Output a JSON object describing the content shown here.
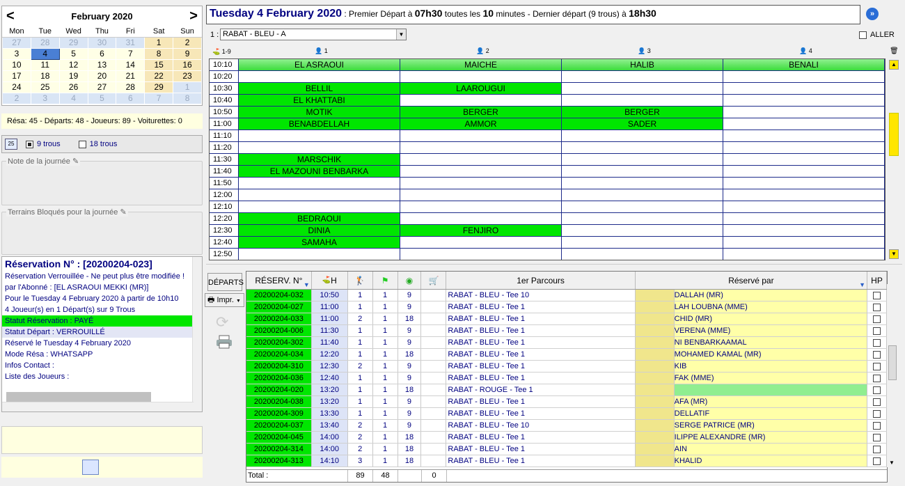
{
  "calendar": {
    "month": "February 2020",
    "prev": "<",
    "next": ">",
    "weekdays": [
      "Mon",
      "Tue",
      "Wed",
      "Thu",
      "Fri",
      "Sat",
      "Sun"
    ],
    "weeks": [
      [
        "27",
        "28",
        "29",
        "30",
        "31",
        "1",
        "2"
      ],
      [
        "3",
        "4",
        "5",
        "6",
        "7",
        "8",
        "9"
      ],
      [
        "10",
        "11",
        "12",
        "13",
        "14",
        "15",
        "16"
      ],
      [
        "17",
        "18",
        "19",
        "20",
        "21",
        "22",
        "23"
      ],
      [
        "24",
        "25",
        "26",
        "27",
        "28",
        "29",
        "1"
      ],
      [
        "2",
        "3",
        "4",
        "5",
        "6",
        "7",
        "8"
      ]
    ],
    "selected": "4"
  },
  "stats": "Résa: 45 - Départs: 48 - Joueurs: 89 - Voiturettes: 0",
  "holes": {
    "cal_icon": "25",
    "nine": "9 trous",
    "eighteen": "18 trous"
  },
  "note_label": "Note de la journée",
  "blocked_label": "Terrains Bloqués pour la journée",
  "reservation": {
    "title": "Réservation N° : [20200204-023]",
    "lines": [
      "Réservation Verrouillée - Ne peut plus être modifiée !",
      "par l'Abonné : [EL ASRAOUI MEKKI (MR)]",
      "Pour le Tuesday 4 February 2020 à partir de 10h10",
      "4 Joueur(s) en 1 Départ(s) sur 9 Trous"
    ],
    "status_paid": "Statut Réservation : PAYÉ",
    "status_locked": "Statut Départ : VERROUILLÉ",
    "lines2": [
      "Réservé le Tuesday 4 February 2020",
      "Mode Résa : WHATSAPP",
      "Infos Contact :",
      "Liste des Joueurs :"
    ]
  },
  "topbar": {
    "date": "Tuesday 4 February 2020",
    "p1": " : Premier Départ à ",
    "t1": "07h30",
    "p2": " toutes les ",
    "t2": "10",
    "p3": " minutes - Dernier départ (9 trous) à ",
    "t3": "18h30"
  },
  "course": {
    "label": "1 :",
    "value": "RABAT - BLEU - A",
    "aller": "ALLER"
  },
  "grid": {
    "hole_hdr": "1-9",
    "players": [
      "1",
      "2",
      "3",
      "4"
    ],
    "rows": [
      {
        "t": "10:10",
        "c": [
          "EL ASRAOUI",
          "MAICHE",
          "HALIB",
          "BENALI"
        ],
        "h": true
      },
      {
        "t": "10:20",
        "c": [
          "",
          "",
          "",
          ""
        ]
      },
      {
        "t": "10:30",
        "c": [
          "BELLIL",
          "LAAROUGUI",
          "",
          ""
        ]
      },
      {
        "t": "10:40",
        "c": [
          "EL KHATTABI",
          "",
          "",
          ""
        ]
      },
      {
        "t": "10:50",
        "c": [
          "MOTIK",
          "BERGER",
          "BERGER",
          ""
        ]
      },
      {
        "t": "11:00",
        "c": [
          "BENABDELLAH",
          "AMMOR",
          "SADER",
          ""
        ]
      },
      {
        "t": "11:10",
        "c": [
          "",
          "",
          "",
          ""
        ]
      },
      {
        "t": "11:20",
        "c": [
          "",
          "",
          "",
          ""
        ]
      },
      {
        "t": "11:30",
        "c": [
          "MARSCHIK",
          "",
          "",
          ""
        ]
      },
      {
        "t": "11:40",
        "c": [
          "EL MAZOUNI BENBARKA",
          "",
          "",
          ""
        ]
      },
      {
        "t": "11:50",
        "c": [
          "",
          "",
          "",
          ""
        ]
      },
      {
        "t": "12:00",
        "c": [
          "",
          "",
          "",
          ""
        ]
      },
      {
        "t": "12:10",
        "c": [
          "",
          "",
          "",
          ""
        ]
      },
      {
        "t": "12:20",
        "c": [
          "BEDRAOUI",
          "",
          "",
          ""
        ]
      },
      {
        "t": "12:30",
        "c": [
          "DINIA",
          "FENJIRO",
          "",
          ""
        ]
      },
      {
        "t": "12:40",
        "c": [
          "SAMAHA",
          "",
          "",
          ""
        ]
      },
      {
        "t": "12:50",
        "c": [
          "",
          "",
          "",
          ""
        ]
      }
    ]
  },
  "bottom": {
    "departs": "DÉPARTS",
    "impr": "Impr.",
    "headers": {
      "resa": "RÉSERV. N°",
      "h": "H",
      "parcours": "1er Parcours",
      "reserve_par": "Réservé par",
      "hp": "HP"
    },
    "rows": [
      [
        "20200204-032",
        "10:50",
        "1",
        "1",
        "9",
        "",
        "RABAT - BLEU - Tee 10",
        "DALLAH (MR)"
      ],
      [
        "20200204-027",
        "11:00",
        "1",
        "1",
        "9",
        "",
        "RABAT - BLEU - Tee 1",
        "LAH LOUBNA (MME)"
      ],
      [
        "20200204-033",
        "11:00",
        "2",
        "1",
        "18",
        "",
        "RABAT - BLEU - Tee 1",
        "CHID (MR)"
      ],
      [
        "20200204-006",
        "11:30",
        "1",
        "1",
        "9",
        "",
        "RABAT - BLEU - Tee 1",
        "VERENA (MME)"
      ],
      [
        "20200204-302",
        "11:40",
        "1",
        "1",
        "9",
        "",
        "RABAT - BLEU - Tee 1",
        "NI BENBARKAAMAL"
      ],
      [
        "20200204-034",
        "12:20",
        "1",
        "1",
        "18",
        "",
        "RABAT - BLEU - Tee 1",
        "MOHAMED KAMAL (MR)"
      ],
      [
        "20200204-310",
        "12:30",
        "2",
        "1",
        "9",
        "",
        "RABAT - BLEU - Tee 1",
        "KIB"
      ],
      [
        "20200204-036",
        "12:40",
        "1",
        "1",
        "9",
        "",
        "RABAT - BLEU - Tee 1",
        "FAK (MME)"
      ],
      [
        "20200204-020",
        "13:20",
        "1",
        "1",
        "18",
        "",
        "RABAT - ROUGE - Tee 1",
        ""
      ],
      [
        "20200204-038",
        "13:20",
        "1",
        "1",
        "9",
        "",
        "RABAT - BLEU - Tee 1",
        "AFA (MR)"
      ],
      [
        "20200204-309",
        "13:30",
        "1",
        "1",
        "9",
        "",
        "RABAT - BLEU - Tee 1",
        "DELLATIF"
      ],
      [
        "20200204-037",
        "13:40",
        "2",
        "1",
        "9",
        "",
        "RABAT - BLEU - Tee 10",
        "SERGE PATRICE (MR)"
      ],
      [
        "20200204-045",
        "14:00",
        "2",
        "1",
        "18",
        "",
        "RABAT - BLEU - Tee 1",
        "ILIPPE ALEXANDRE (MR)"
      ],
      [
        "20200204-314",
        "14:00",
        "2",
        "1",
        "18",
        "",
        "RABAT - BLEU - Tee 1",
        "AIN"
      ],
      [
        "20200204-313",
        "14:10",
        "3",
        "1",
        "18",
        "",
        "RABAT - BLEU - Tee 1",
        "KHALID"
      ]
    ],
    "total": {
      "label": "Total :",
      "players": "89",
      "departs": "48",
      "carts": "0"
    }
  }
}
